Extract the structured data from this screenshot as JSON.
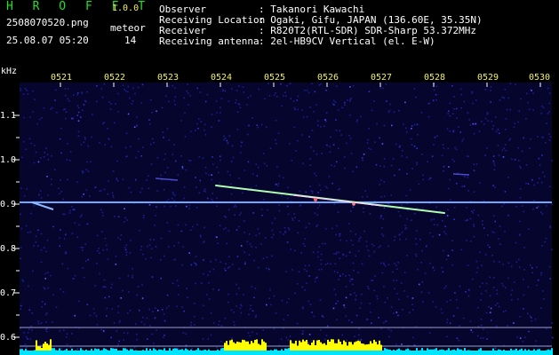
{
  "app": {
    "logo": "H R O F F T",
    "version": "1.0.0"
  },
  "file": {
    "name": "2508070520.png",
    "datetime": "25.08.07 05:20"
  },
  "meteor": {
    "label": "meteor",
    "count": "14"
  },
  "info": [
    {
      "label": "Observer",
      "value": ": Takanori Kawachi"
    },
    {
      "label": "Receiving Location",
      "value": ": Ogaki, Gifu, JAPAN (136.60E, 35.35N)"
    },
    {
      "label": "Receiver",
      "value": ": R820T2(RTL-SDR) SDR-Sharp 53.372MHz"
    },
    {
      "label": "Receiving antenna",
      "value": ": 2el-HB9CV Vertical (el. E-W)"
    }
  ],
  "axis": {
    "y_unit": "kHz",
    "y_ticks": [
      "1.1",
      "1.0",
      "0.9",
      "0.8",
      "0.7",
      "0.6"
    ],
    "x_ticks": [
      "0521",
      "0522",
      "0523",
      "0524",
      "0525",
      "0526",
      "0527",
      "0528",
      "0529",
      "0530"
    ]
  },
  "colors": {
    "background": "#000000",
    "noise": "#1e1e8c",
    "carrier": "#6fa8ff",
    "meteor": "#b0ffb0",
    "level": "#ffff00",
    "level_base": "#00e5ff",
    "tick_label": "#f0f060",
    "logo": "#22e022"
  }
}
